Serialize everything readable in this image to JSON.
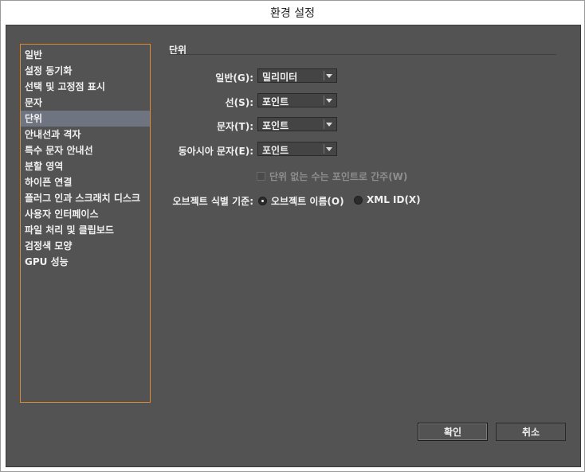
{
  "window": {
    "title": "환경 설정"
  },
  "sidebar": {
    "items": [
      {
        "label": "일반",
        "selected": false
      },
      {
        "label": "설정 동기화",
        "selected": false
      },
      {
        "label": "선택 및 고정점 표시",
        "selected": false
      },
      {
        "label": "문자",
        "selected": false
      },
      {
        "label": "단위",
        "selected": true
      },
      {
        "label": "안내선과 격자",
        "selected": false
      },
      {
        "label": "특수 문자 안내선",
        "selected": false
      },
      {
        "label": "분할 영역",
        "selected": false
      },
      {
        "label": "하이픈 연결",
        "selected": false
      },
      {
        "label": "플러그 인과 스크래치 디스크",
        "selected": false
      },
      {
        "label": "사용자 인터페이스",
        "selected": false
      },
      {
        "label": "파일 처리 및 클립보드",
        "selected": false
      },
      {
        "label": "검정색 모양",
        "selected": false
      },
      {
        "label": "GPU 성능",
        "selected": false
      }
    ]
  },
  "units": {
    "section_title": "단위",
    "general": {
      "label": "일반(G):",
      "value": "밀리미터"
    },
    "stroke": {
      "label": "선(S):",
      "value": "포인트"
    },
    "type": {
      "label": "문자(T):",
      "value": "포인트"
    },
    "asian_type": {
      "label": "동아시아 문자(E):",
      "value": "포인트"
    },
    "numbers_without_units": {
      "label": "단위 없는 수는 포인트로 간주(W)",
      "checked": false,
      "enabled": false
    },
    "identify_objects": {
      "label": "오브젝트 식별 기준:",
      "options": [
        {
          "label": "오브젝트 이름(O)",
          "selected": true
        },
        {
          "label": "XML ID(X)",
          "selected": false
        }
      ]
    }
  },
  "buttons": {
    "ok": "확인",
    "cancel": "취소"
  },
  "colors": {
    "panel": "#535353",
    "sidebar_border": "#e08a2e",
    "selected_row": "#6e7580"
  }
}
